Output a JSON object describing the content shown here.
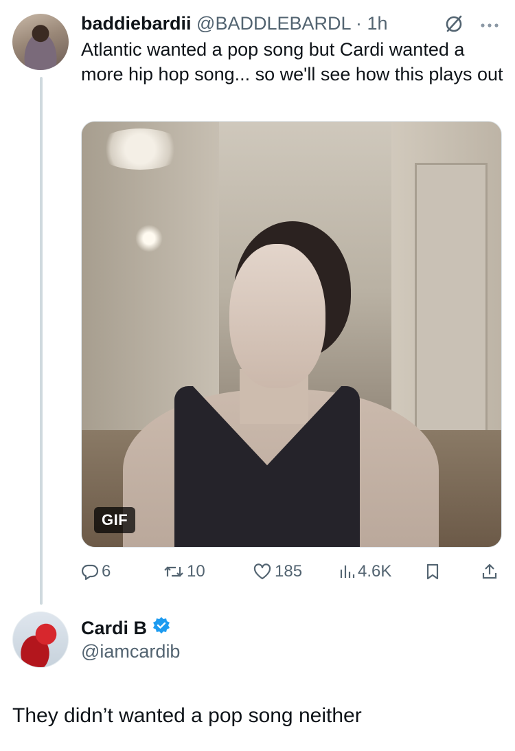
{
  "tweet1": {
    "display_name": "baddiebardii",
    "handle_time": "@BADDLEBARDL · 1h",
    "text": "Atlantic wanted a pop song but Cardi wanted a more hip hop song... so we'll see how this plays out",
    "media": {
      "badge": "GIF"
    },
    "actions": {
      "replies": "6",
      "reposts": "10",
      "likes": "185",
      "views": "4.6K"
    }
  },
  "tweet2": {
    "display_name": "Cardi B",
    "handle": "@iamcardib",
    "text": "They didn’t wanted a pop song neither"
  },
  "colors": {
    "text": "#0f1419",
    "secondary": "#536471",
    "verified": "#1d9bf0",
    "thread_line": "#cfd9de"
  },
  "icons": [
    "grok-slash-icon",
    "more-icon",
    "reply-icon",
    "repost-icon",
    "like-icon",
    "views-icon",
    "bookmark-icon",
    "share-icon",
    "verified-badge-icon"
  ]
}
